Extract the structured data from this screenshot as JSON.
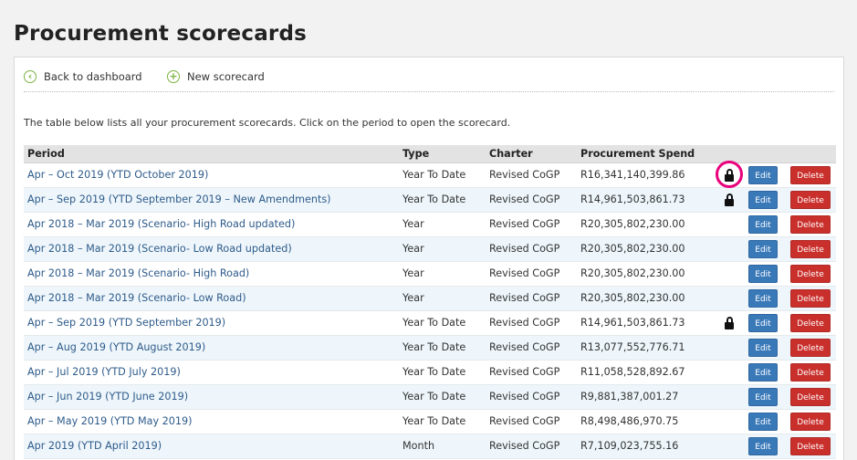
{
  "page": {
    "title": "Procurement scorecards"
  },
  "toolbar": {
    "back_label": "Back to dashboard",
    "new_label": "New scorecard",
    "back_icon": "arrow-left-circle-icon",
    "new_icon": "plus-circle-icon"
  },
  "intro": "The table below lists all your procurement scorecards. Click on the period to open the scorecard.",
  "table": {
    "headers": {
      "period": "Period",
      "type": "Type",
      "charter": "Charter",
      "spend": "Procurement Spend"
    },
    "rows": [
      {
        "period": "Apr – Oct 2019 (YTD October 2019)",
        "type": "Year To Date",
        "charter": "Revised CoGP",
        "spend": "R16,341,140,399.86",
        "locked": true,
        "highlighted": true,
        "edit": "Edit",
        "delete": "Delete"
      },
      {
        "period": "Apr – Sep 2019 (YTD September 2019 – New Amendments)",
        "type": "Year To Date",
        "charter": "Revised CoGP",
        "spend": "R14,961,503,861.73",
        "locked": true,
        "highlighted": false,
        "edit": "Edit",
        "delete": "Delete"
      },
      {
        "period": "Apr 2018 – Mar 2019 (Scenario- High Road updated)",
        "type": "Year",
        "charter": "Revised CoGP",
        "spend": "R20,305,802,230.00",
        "locked": false,
        "highlighted": false,
        "edit": "Edit",
        "delete": "Delete"
      },
      {
        "period": "Apr 2018 – Mar 2019 (Scenario- Low Road updated)",
        "type": "Year",
        "charter": "Revised CoGP",
        "spend": "R20,305,802,230.00",
        "locked": false,
        "highlighted": false,
        "edit": "Edit",
        "delete": "Delete"
      },
      {
        "period": "Apr 2018 – Mar 2019 (Scenario- High Road)",
        "type": "Year",
        "charter": "Revised CoGP",
        "spend": "R20,305,802,230.00",
        "locked": false,
        "highlighted": false,
        "edit": "Edit",
        "delete": "Delete"
      },
      {
        "period": "Apr 2018 – Mar 2019 (Scenario- Low Road)",
        "type": "Year",
        "charter": "Revised CoGP",
        "spend": "R20,305,802,230.00",
        "locked": false,
        "highlighted": false,
        "edit": "Edit",
        "delete": "Delete"
      },
      {
        "period": "Apr – Sep 2019 (YTD September 2019)",
        "type": "Year To Date",
        "charter": "Revised CoGP",
        "spend": "R14,961,503,861.73",
        "locked": true,
        "highlighted": false,
        "edit": "Edit",
        "delete": "Delete"
      },
      {
        "period": "Apr – Aug 2019 (YTD August 2019)",
        "type": "Year To Date",
        "charter": "Revised CoGP",
        "spend": "R13,077,552,776.71",
        "locked": false,
        "highlighted": false,
        "edit": "Edit",
        "delete": "Delete"
      },
      {
        "period": "Apr – Jul 2019 (YTD July 2019)",
        "type": "Year To Date",
        "charter": "Revised CoGP",
        "spend": "R11,058,528,892.67",
        "locked": false,
        "highlighted": false,
        "edit": "Edit",
        "delete": "Delete"
      },
      {
        "period": "Apr – Jun 2019 (YTD June 2019)",
        "type": "Year To Date",
        "charter": "Revised CoGP",
        "spend": "R9,881,387,001.27",
        "locked": false,
        "highlighted": false,
        "edit": "Edit",
        "delete": "Delete"
      },
      {
        "period": "Apr – May 2019 (YTD May 2019)",
        "type": "Year To Date",
        "charter": "Revised CoGP",
        "spend": "R8,498,486,970.75",
        "locked": false,
        "highlighted": false,
        "edit": "Edit",
        "delete": "Delete"
      },
      {
        "period": "Apr 2019 (YTD April 2019)",
        "type": "Month",
        "charter": "Revised CoGP",
        "spend": "R7,109,023,755.16",
        "locked": false,
        "highlighted": false,
        "edit": "Edit",
        "delete": "Delete"
      }
    ]
  },
  "colors": {
    "edit_button": "#3a79b8",
    "delete_button": "#c9302c",
    "toolbar_icon": "#7cb342",
    "highlight_ring": "#e8007c",
    "row_alt": "#eef6fb",
    "link": "#2e5b8a"
  }
}
